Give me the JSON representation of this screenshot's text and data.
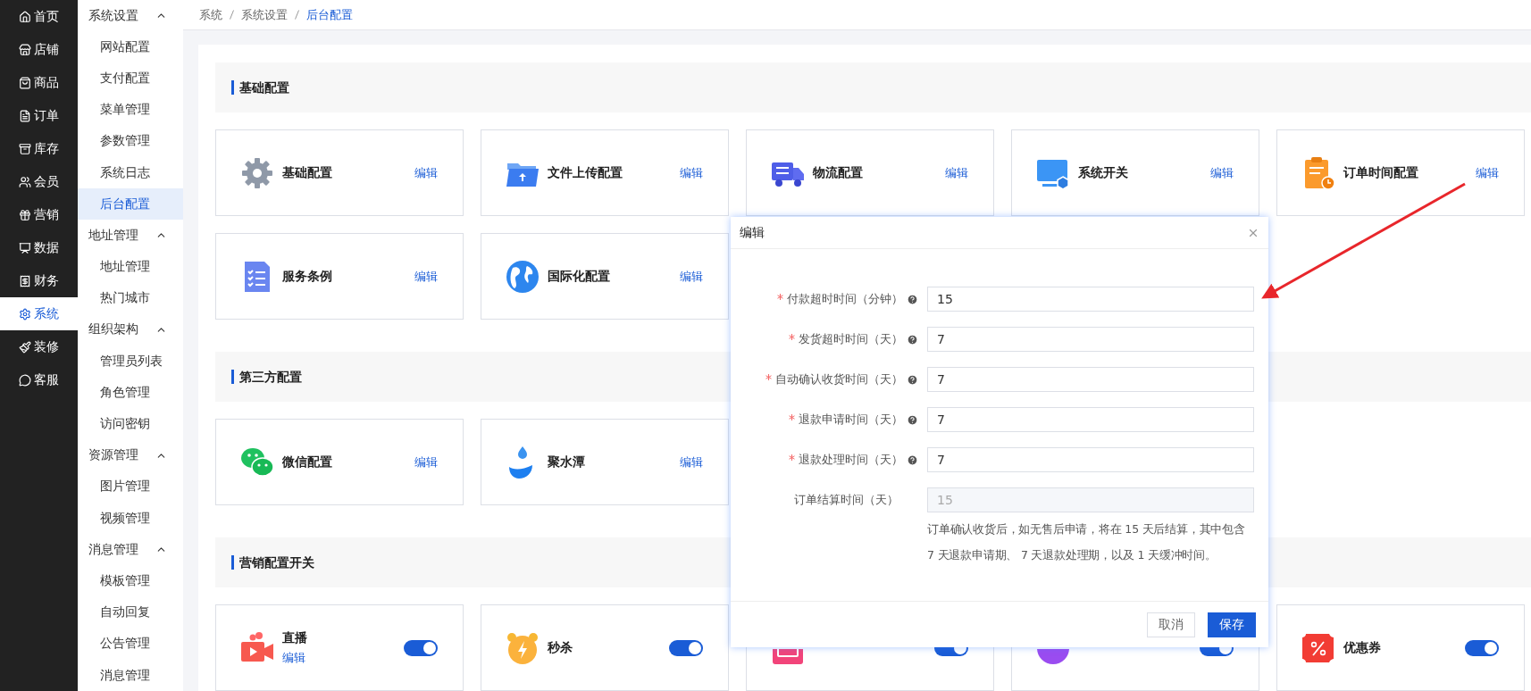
{
  "nav": [
    {
      "label": "首页",
      "selected": false
    },
    {
      "label": "店铺",
      "selected": false
    },
    {
      "label": "商品",
      "selected": false
    },
    {
      "label": "订单",
      "selected": false
    },
    {
      "label": "库存",
      "selected": false
    },
    {
      "label": "会员",
      "selected": false
    },
    {
      "label": "营销",
      "selected": false
    },
    {
      "label": "数据",
      "selected": false
    },
    {
      "label": "财务",
      "selected": false
    },
    {
      "label": "系统",
      "selected": true
    },
    {
      "label": "装修",
      "selected": false
    },
    {
      "label": "客服",
      "selected": false
    }
  ],
  "submenu": [
    {
      "label": "系统设置",
      "expanded": true,
      "children": [
        {
          "label": "网站配置",
          "selected": false
        },
        {
          "label": "支付配置",
          "selected": false
        },
        {
          "label": "菜单管理",
          "selected": false
        },
        {
          "label": "参数管理",
          "selected": false
        },
        {
          "label": "系统日志",
          "selected": false
        },
        {
          "label": "后台配置",
          "selected": true
        }
      ]
    },
    {
      "label": "地址管理",
      "expanded": true,
      "children": [
        {
          "label": "地址管理",
          "selected": false
        },
        {
          "label": "热门城市",
          "selected": false
        }
      ]
    },
    {
      "label": "组织架构",
      "expanded": true,
      "children": [
        {
          "label": "管理员列表",
          "selected": false
        },
        {
          "label": "角色管理",
          "selected": false
        },
        {
          "label": "访问密钥",
          "selected": false
        }
      ]
    },
    {
      "label": "资源管理",
      "expanded": true,
      "children": [
        {
          "label": "图片管理",
          "selected": false
        },
        {
          "label": "视频管理",
          "selected": false
        }
      ]
    },
    {
      "label": "消息管理",
      "expanded": true,
      "children": [
        {
          "label": "模板管理",
          "selected": false
        },
        {
          "label": "自动回复",
          "selected": false
        },
        {
          "label": "公告管理",
          "selected": false
        },
        {
          "label": "消息管理",
          "selected": false
        }
      ]
    }
  ],
  "breadcrumb": [
    "系统",
    "系统设置",
    "后台配置"
  ],
  "sections": [
    {
      "title": "基础配置",
      "cards": [
        {
          "kind": "link",
          "title": "基础配置",
          "edit_label": "编辑"
        },
        {
          "kind": "link",
          "title": "文件上传配置",
          "edit_label": "编辑"
        },
        {
          "kind": "link",
          "title": "物流配置",
          "edit_label": "编辑"
        },
        {
          "kind": "link",
          "title": "系统开关",
          "edit_label": "编辑"
        },
        {
          "kind": "link",
          "title": "订单时间配置",
          "edit_label": "编辑"
        },
        {
          "kind": "link",
          "title": "服务条例",
          "edit_label": "编辑"
        },
        {
          "kind": "link",
          "title": "国际化配置",
          "edit_label": "编辑"
        }
      ]
    },
    {
      "title": "第三方配置",
      "cards": [
        {
          "kind": "link",
          "title": "微信配置",
          "edit_label": "编辑"
        },
        {
          "kind": "link",
          "title": "聚水潭",
          "edit_label": "编辑"
        }
      ]
    },
    {
      "title": "营销配置开关",
      "cards": [
        {
          "kind": "switch",
          "title": "直播",
          "edit_label": "编辑",
          "on": true
        },
        {
          "kind": "switch",
          "title": "秒杀",
          "on": true
        },
        {
          "kind": "switch",
          "on": true
        },
        {
          "kind": "switch",
          "on": true
        },
        {
          "kind": "switch",
          "title": "优惠券",
          "on": true
        }
      ]
    }
  ],
  "dialog": {
    "title": "编辑",
    "fields": [
      {
        "label": "付款超时时间（分钟）",
        "required": true,
        "help": true,
        "value": "15",
        "disabled": false
      },
      {
        "label": "发货超时时间（天）",
        "required": true,
        "help": true,
        "value": "7",
        "disabled": false
      },
      {
        "label": "自动确认收货时间（天）",
        "required": true,
        "help": true,
        "value": "7",
        "disabled": false
      },
      {
        "label": "退款申请时间（天）",
        "required": true,
        "help": true,
        "value": "7",
        "disabled": false
      },
      {
        "label": "退款处理时间（天）",
        "required": true,
        "help": true,
        "value": "7",
        "disabled": false
      },
      {
        "label": "订单结算时间（天）",
        "required": false,
        "help": false,
        "value": "15",
        "disabled": true,
        "note": "订单确认收货后，如无售后申请，将在 15 天后结算，其中包含 7 天退款申请期、 7 天退款处理期，以及 1 天缓冲时间。"
      }
    ],
    "buttons": [
      {
        "label": "取消",
        "kind": "secondary"
      },
      {
        "label": "保存",
        "kind": "primary"
      }
    ]
  }
}
